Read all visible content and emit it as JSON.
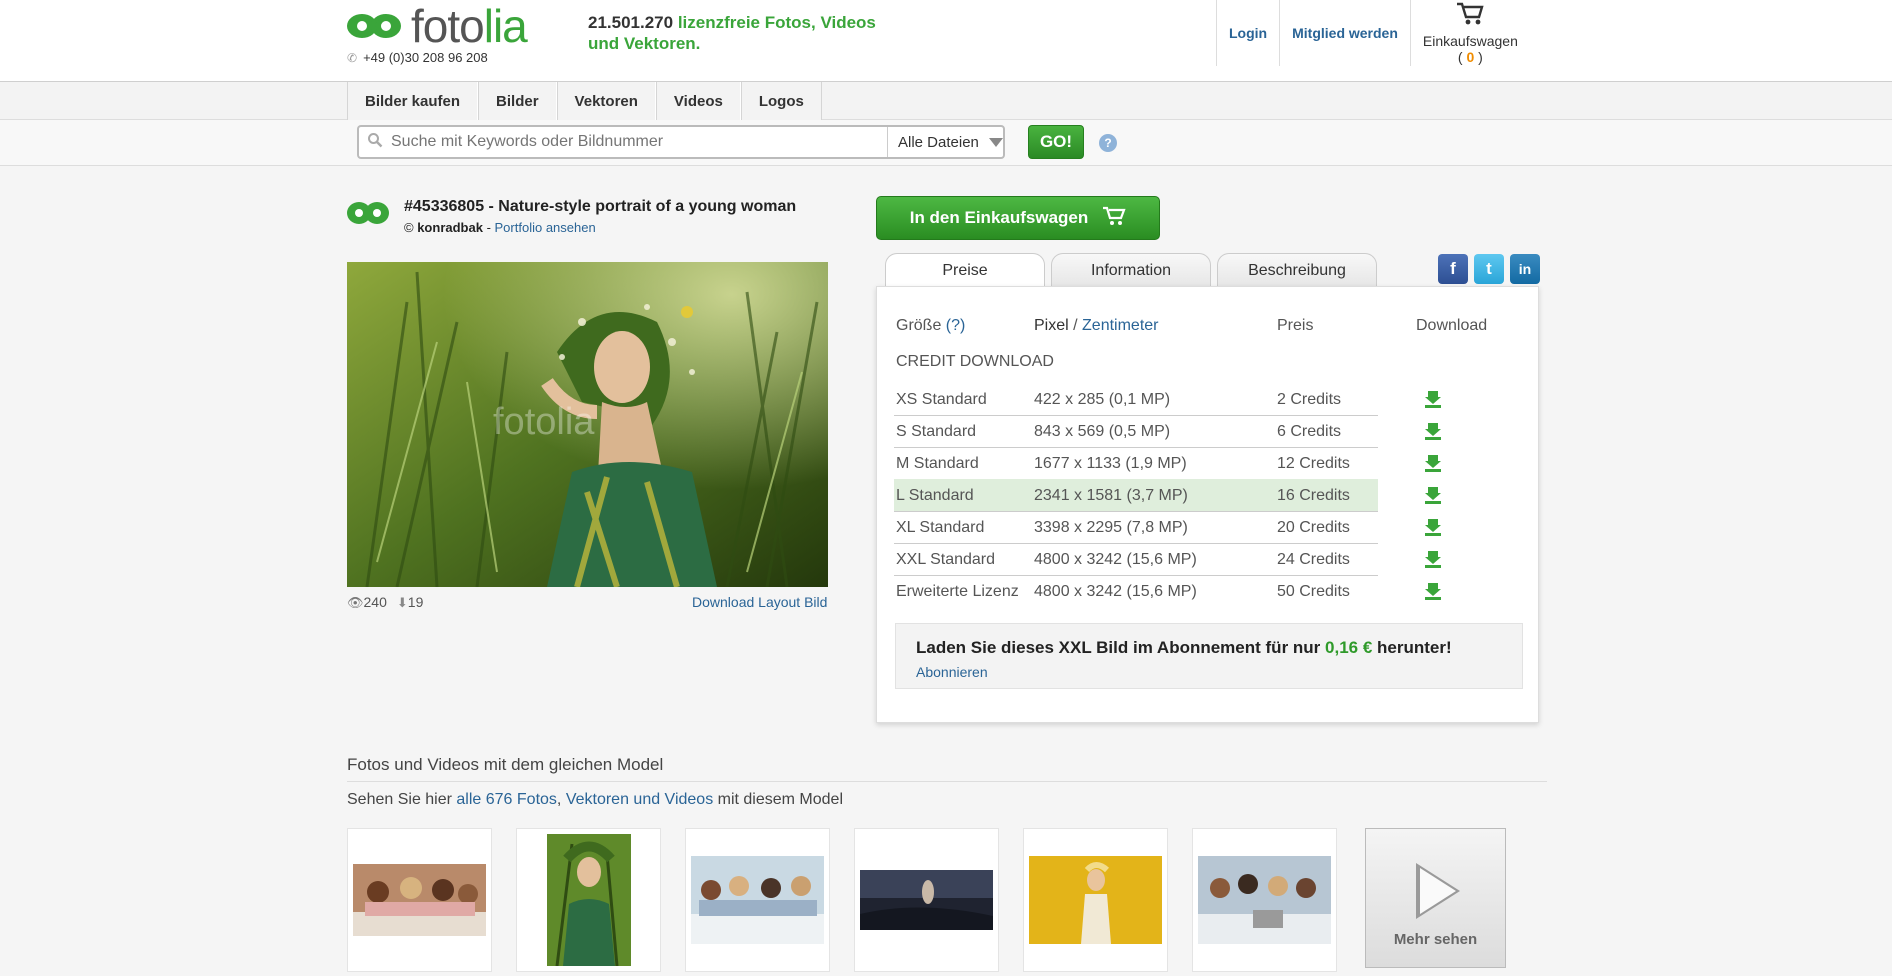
{
  "header": {
    "logo_text_a": "foto",
    "logo_text_b": "lia",
    "phone": "+49 (0)30 208 96 208",
    "tagline_count": "21.501.270",
    "tagline_rest": " lizenzfreie Fotos, Videos und Vektoren.",
    "login": "Login",
    "signup": "Mitglied werden",
    "cart_label": "Einkaufswagen",
    "cart_count_open": "( ",
    "cart_count": "0",
    "cart_count_close": " )"
  },
  "nav": {
    "items": [
      {
        "label": "Bilder kaufen"
      },
      {
        "label": "Bilder"
      },
      {
        "label": "Vektoren"
      },
      {
        "label": "Videos"
      },
      {
        "label": "Logos"
      }
    ]
  },
  "search": {
    "placeholder": "Suche mit Keywords oder Bildnummer",
    "filter": "Alle Dateien",
    "go": "GO!",
    "help": "?"
  },
  "image": {
    "title": "#45336805 - Nature-style portrait of a young woman",
    "author_prefix": "© ",
    "author": "konradbak",
    "author_sep": " - ",
    "portfolio_link": "Portfolio ansehen",
    "views": "240",
    "downloads": "19",
    "layout_link": "Download Layout Bild",
    "watermark": "fotolia"
  },
  "cart_button": "In den Einkaufswagen",
  "tabs": [
    {
      "label": "Preise"
    },
    {
      "label": "Information"
    },
    {
      "label": "Beschreibung"
    }
  ],
  "social": {
    "fb": "f",
    "tw": "t",
    "li": "in"
  },
  "price_table": {
    "col_size": "Größe ",
    "col_size_help": "(?)",
    "col_pixel": "Pixel",
    "col_slash": " / ",
    "col_cm": "Zentimeter",
    "col_price": "Preis",
    "col_download": "Download",
    "section": "CREDIT DOWNLOAD",
    "rows": [
      {
        "size": "XS Standard",
        "dims": "422 x 285 (0,1 MP)",
        "price": "2 Credits"
      },
      {
        "size": "S Standard",
        "dims": "843 x 569 (0,5 MP)",
        "price": "6 Credits"
      },
      {
        "size": "M Standard",
        "dims": "1677 x 1133 (1,9 MP)",
        "price": "12 Credits"
      },
      {
        "size": "L Standard",
        "dims": "2341 x 1581 (3,7 MP)",
        "price": "16 Credits"
      },
      {
        "size": "XL Standard",
        "dims": "3398 x 2295 (7,8 MP)",
        "price": "20 Credits"
      },
      {
        "size": "XXL Standard",
        "dims": "4800 x 3242 (15,6 MP)",
        "price": "24 Credits"
      },
      {
        "size": "Erweiterte Lizenz",
        "dims": "4800 x 3242 (15,6 MP)",
        "price": "50 Credits"
      }
    ],
    "highlighted_row": "L Standard"
  },
  "subscription": {
    "text_a": "Laden Sie dieses XXL Bild im Abonnement für nur ",
    "price": "0,16 €",
    "text_b": " herunter!",
    "link": "Abonnieren"
  },
  "related": {
    "title": "Fotos und Videos mit dem gleichen Model",
    "sub_a": "Sehen Sie hier ",
    "sub_link1": "alle 676 Fotos",
    "sub_comma": ", ",
    "sub_link2": "Vektoren und Videos",
    "sub_b": " mit diesem Model",
    "more": "Mehr sehen"
  },
  "colors": {
    "brand_green": "#3aa53a",
    "link_blue": "#2a6496",
    "highlight_row": "#dfeedc",
    "cart_count": "#f08c00"
  }
}
